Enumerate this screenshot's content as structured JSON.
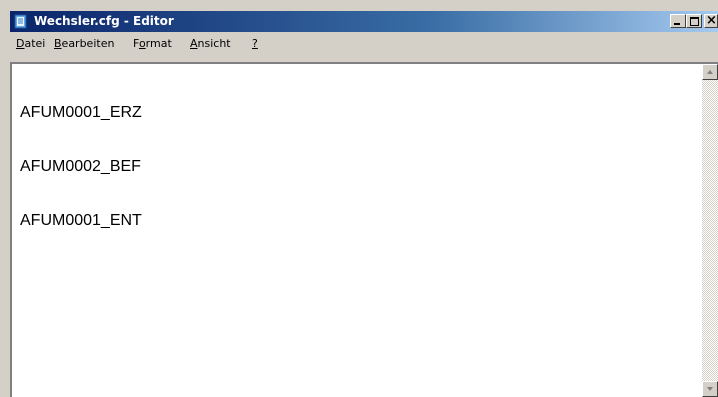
{
  "window": {
    "title": "Wechsler.cfg - Editor",
    "icon": "notepad-icon",
    "colors": {
      "titlebar_start": "#0a246a",
      "titlebar_end": "#a6caf0",
      "face": "#d4d0c8"
    }
  },
  "menubar": {
    "items": [
      {
        "accel": "D",
        "rest": "atei"
      },
      {
        "accel": "B",
        "rest": "earbeiten"
      },
      {
        "pre": "F",
        "accel": "o",
        "rest": "rmat"
      },
      {
        "accel": "A",
        "rest": "nsicht"
      },
      {
        "accel": "?",
        "rest": ""
      }
    ]
  },
  "editor": {
    "lines": [
      "AFUM0001_ERZ",
      "AFUM0002_BEF",
      "AFUM0001_ENT"
    ]
  }
}
